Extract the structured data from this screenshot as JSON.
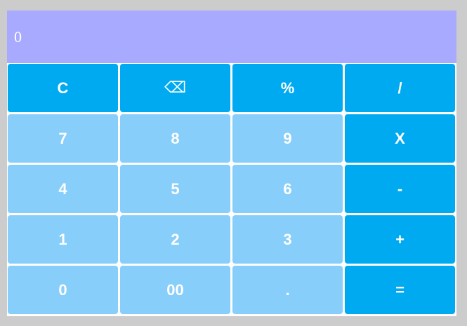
{
  "display": {
    "value": "0"
  },
  "keys": {
    "clear": "C",
    "backspace": "⌫",
    "percent": "%",
    "divide": "/",
    "seven": "7",
    "eight": "8",
    "nine": "9",
    "multiply": "X",
    "four": "4",
    "five": "5",
    "six": "6",
    "subtract": "-",
    "one": "1",
    "two": "2",
    "three": "3",
    "add": "+",
    "zero": "0",
    "double_zero": "00",
    "decimal": ".",
    "equals": "="
  },
  "colors": {
    "display_bg": "#a8aaff",
    "operator_key": "#00aaf0",
    "number_key": "#87cefa",
    "page_bg": "#cccccc"
  }
}
